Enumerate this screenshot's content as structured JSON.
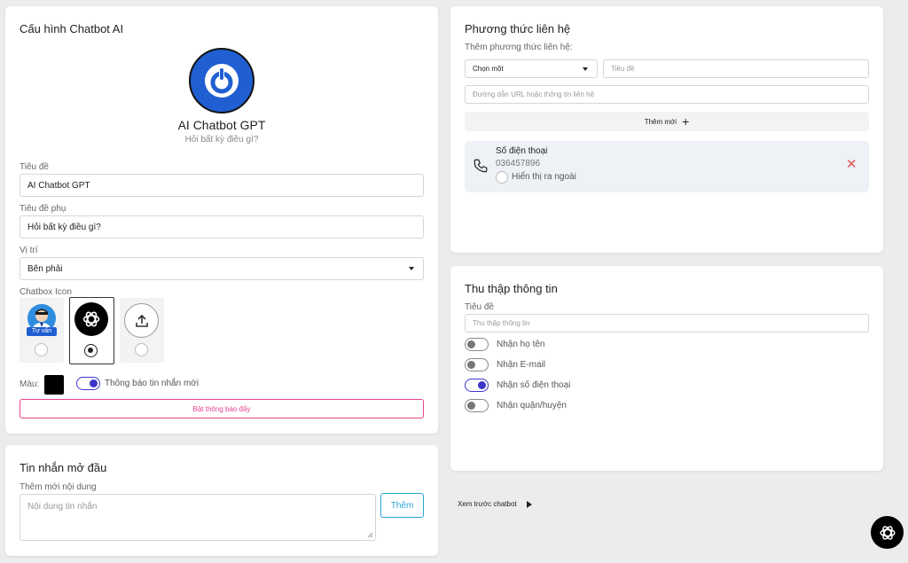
{
  "config": {
    "title": "Cấu hình Chatbot AI",
    "preview_name": "AI Chatbot GPT",
    "preview_subtitle": "Hỏi bất kỳ điều gì?",
    "title_label": "Tiêu đề",
    "title_value": "AI Chatbot GPT",
    "subtitle_label": "Tiêu đề phụ",
    "subtitle_value": "Hỏi bất kỳ điều gì?",
    "position_label": "Vị trí",
    "position_value": "Bên phải",
    "icon_label": "Chatbox Icon",
    "avatar_badge": "Tư vấn",
    "color_label": "Màu:",
    "color_value": "#000000",
    "notify_label": "Thông báo tin nhắn mới",
    "push_button": "Bật thông báo đẩy"
  },
  "opening": {
    "title": "Tin nhắn mở đầu",
    "add_label": "Thêm mới nội dung",
    "placeholder": "Nội dung tin nhắn",
    "add_button": "Thêm"
  },
  "contact": {
    "title": "Phương thức liên hệ",
    "add_label": "Thêm phương thức liên hệ:",
    "select_value": "Chọn một",
    "title_placeholder": "Tiêu đề",
    "url_placeholder": "Đường dẫn URL hoặc thông tin liên hệ",
    "add_button": "Thêm mới",
    "item": {
      "name": "Số điện thoại",
      "value": "036457896",
      "show_label": "Hiển thị ra ngoài"
    }
  },
  "collect": {
    "title": "Thu thập thông tin",
    "title_label": "Tiêu đề",
    "title_placeholder": "Thu thập thông tin",
    "toggles": [
      {
        "label": "Nhận họ tên",
        "on": false
      },
      {
        "label": "Nhận E-mail",
        "on": false
      },
      {
        "label": "Nhận số điện thoại",
        "on": true
      },
      {
        "label": "Nhận quận/huyện",
        "on": false
      }
    ]
  },
  "preview": {
    "label": "Xem trước chatbot"
  },
  "colors": {
    "accent": "#3d35c9",
    "brand_blue": "#1f5fd1",
    "push_pink": "#e8438c",
    "add_blue": "#2aa6d6",
    "delete_red": "#e25555"
  }
}
